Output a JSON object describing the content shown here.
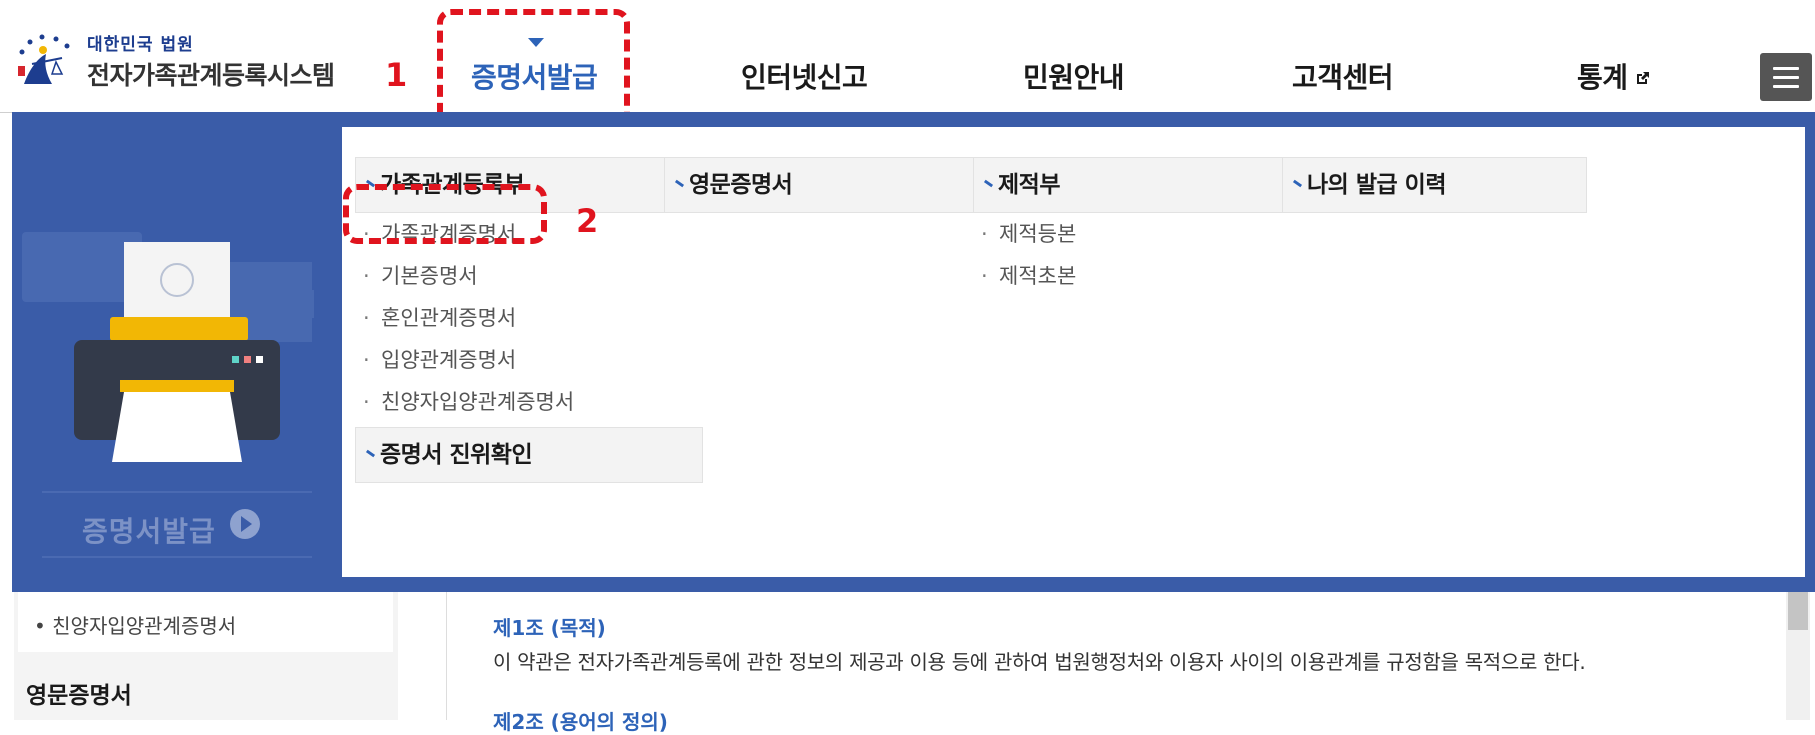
{
  "logo": {
    "top_text": "대한민국 법원",
    "main_text": "전자가족관계등록시스템"
  },
  "nav": {
    "items": [
      {
        "label": "증명서발급"
      },
      {
        "label": "인터넷신고"
      },
      {
        "label": "민원안내"
      },
      {
        "label": "고객센터"
      },
      {
        "label": "통계"
      }
    ]
  },
  "annotations": {
    "step1": "1",
    "step2": "2"
  },
  "mega_menu": {
    "banner_label": "증명서발급",
    "columns": [
      {
        "heading": "가족관계등록부",
        "items": [
          "가족관계증명서",
          "기본증명서",
          "혼인관계증명서",
          "입양관계증명서",
          "친양자입양관계증명서"
        ]
      },
      {
        "heading": "영문증명서",
        "items": []
      },
      {
        "heading": "제적부",
        "items": [
          "제적등본",
          "제적초본"
        ]
      },
      {
        "heading": "나의 발급 이력",
        "items": []
      }
    ],
    "extra_heading": "증명서 진위확인"
  },
  "sidebar": {
    "item": "• 친양자입양관계증명서",
    "heading": "영문증명서"
  },
  "article": {
    "title1": "제1조 (목적)",
    "text1": "이 약관은 전자가족관계등록에 관한 정보의 제공과 이용 등에 관하여 법원행정처와 이용자 사이의 이용관계를 규정함을 목적으로 한다.",
    "title2": "제2조 (용어의 정의)"
  },
  "colors": {
    "accent": "#2d63b8",
    "menu_bg": "#3a5ca8",
    "annotation": "#e0141e"
  }
}
